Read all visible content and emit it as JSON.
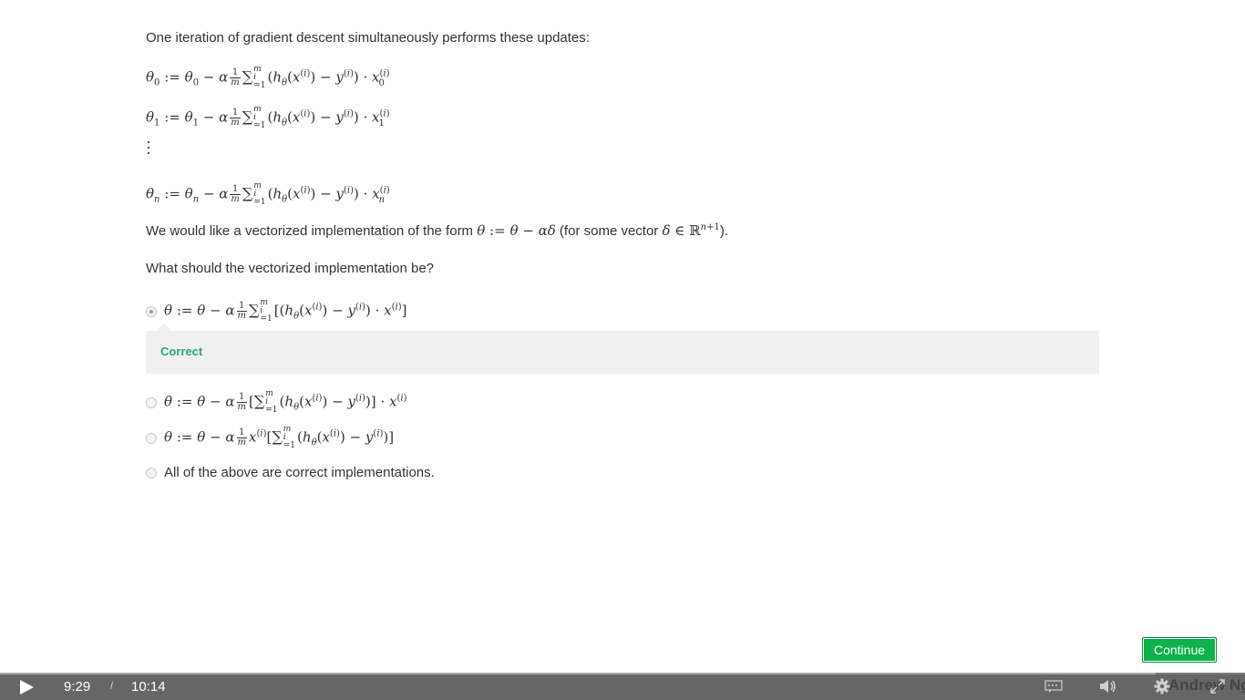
{
  "question": {
    "intro": "One iteration of gradient descent simultaneously performs these updates:",
    "paragraph_vectorized_prefix": "We would like a vectorized implementation of the form ",
    "paragraph_vectorized_middle": " (for some vector ",
    "paragraph_vectorized_suffix": ").",
    "paragraph_ask": "What should the vectorized implementation be?"
  },
  "options": [
    {
      "selected": true
    },
    {
      "selected": false
    },
    {
      "selected": false
    },
    {
      "selected": false,
      "label": "All of the above are correct implementations."
    }
  ],
  "feedback": {
    "label": "Correct",
    "color": "#2aa86a"
  },
  "continue_button": {
    "label": "Continue",
    "color": "#0eb14c"
  },
  "player": {
    "current_time": "9:29",
    "separator": "/",
    "total_time": "10:14",
    "progress_fraction": 0.928,
    "watermark": "Andrew Ng"
  }
}
